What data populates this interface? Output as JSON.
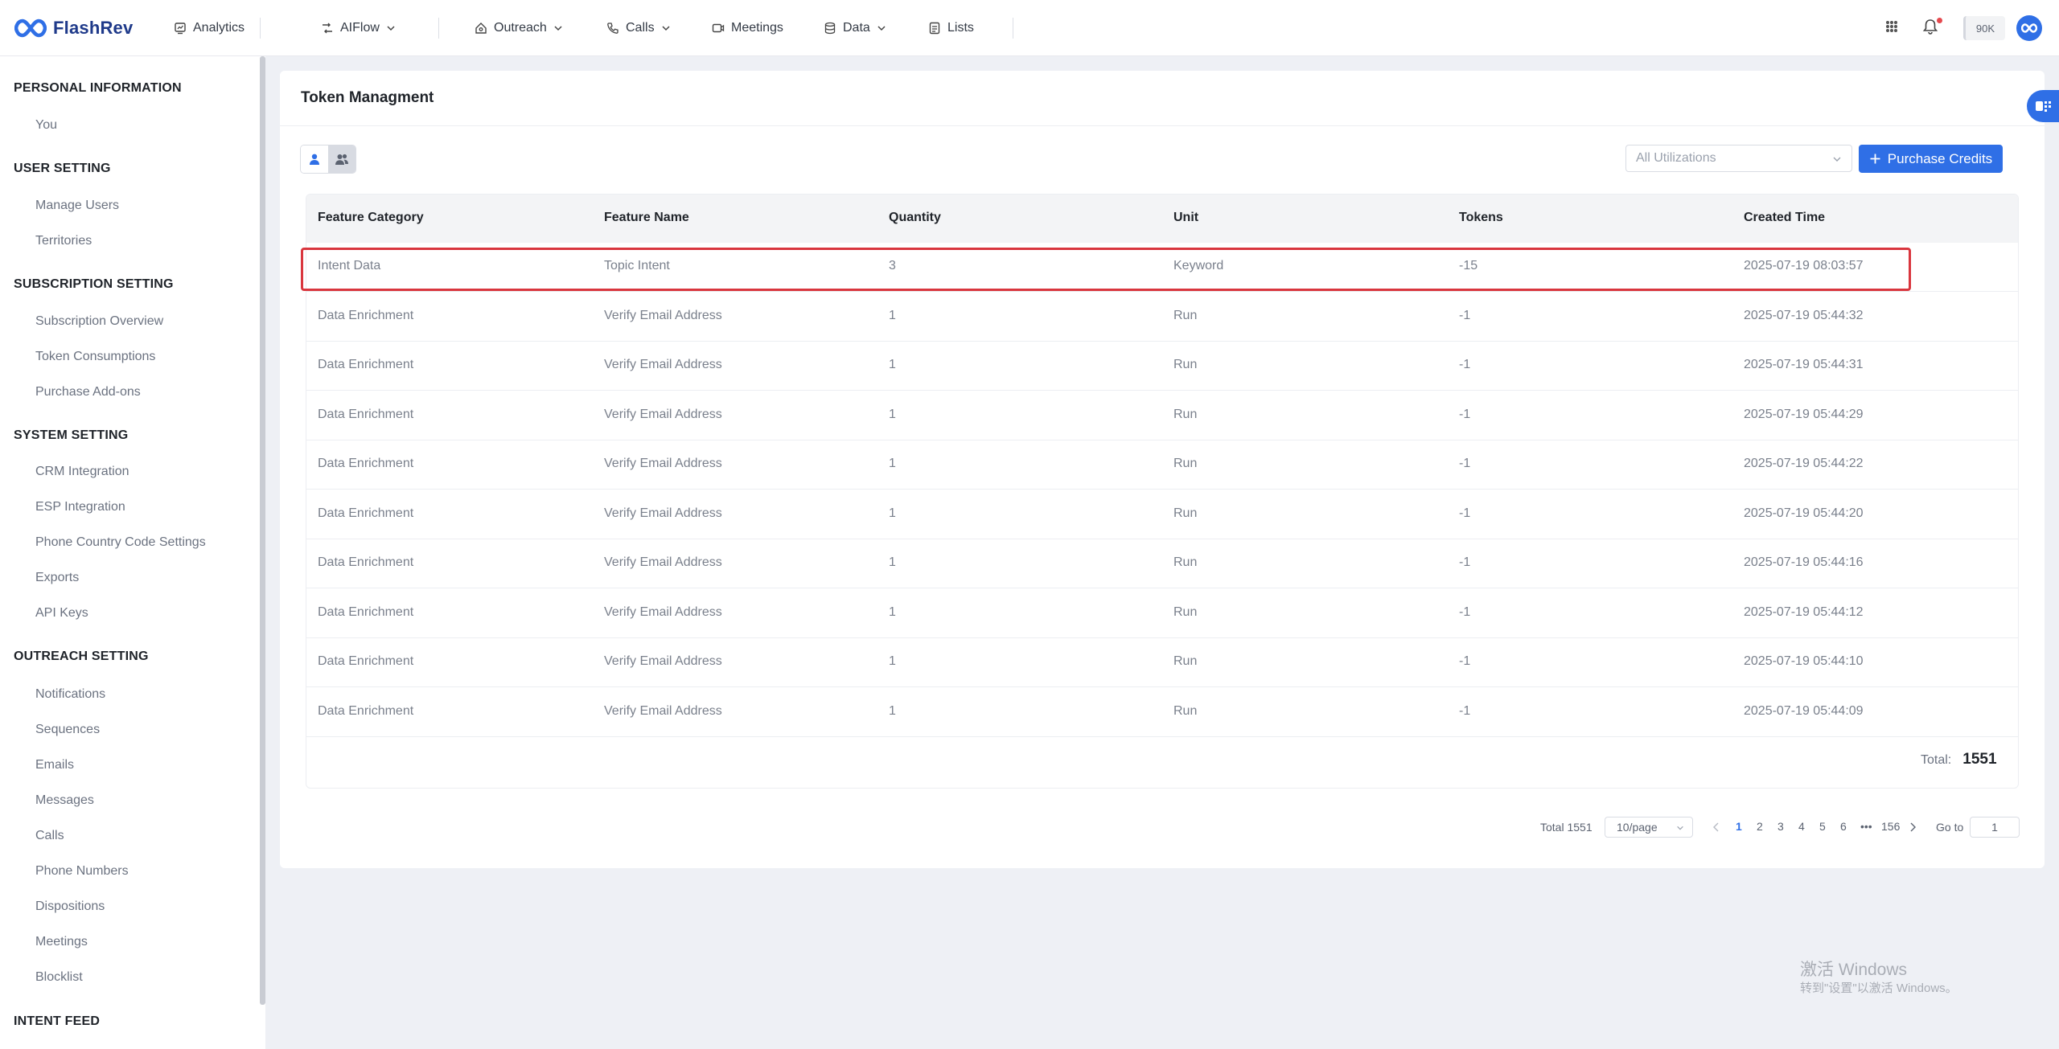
{
  "app": {
    "name": "FlashRev"
  },
  "nav": {
    "items": [
      {
        "label": "Analytics",
        "icon": "analytics-icon"
      },
      {
        "label": "AIFlow",
        "icon": "flow-icon"
      },
      {
        "label": "Outreach",
        "icon": "outreach-icon"
      },
      {
        "label": "Calls",
        "icon": "phone-icon"
      },
      {
        "label": "Meetings",
        "icon": "video-icon"
      },
      {
        "label": "Data",
        "icon": "database-icon"
      },
      {
        "label": "Lists",
        "icon": "list-icon"
      }
    ],
    "credits": "90K"
  },
  "sidebar": {
    "sections": [
      {
        "title": "PERSONAL INFORMATION",
        "items": [
          "You"
        ]
      },
      {
        "title": "USER SETTING",
        "items": [
          "Manage Users",
          "Territories"
        ]
      },
      {
        "title": "SUBSCRIPTION SETTING",
        "items": [
          "Subscription Overview",
          "Token Consumptions",
          "Purchase Add-ons"
        ]
      },
      {
        "title": "SYSTEM SETTING",
        "items": [
          "CRM Integration",
          "ESP Integration",
          "Phone Country Code Settings",
          "Exports",
          "API Keys"
        ]
      },
      {
        "title": "OUTREACH SETTING",
        "items": [
          "Notifications",
          "Sequences",
          "Emails",
          "Messages",
          "Calls",
          "Phone Numbers",
          "Dispositions",
          "Meetings",
          "Blocklist"
        ]
      },
      {
        "title": "INTENT FEED",
        "items": []
      }
    ]
  },
  "main": {
    "title": "Token Managment",
    "filter": {
      "placeholder": "All Utilizations"
    },
    "purchase_button": "Purchase Credits",
    "table": {
      "columns": [
        "Feature Category",
        "Feature Name",
        "Quantity",
        "Unit",
        "Tokens",
        "Created Time"
      ],
      "rows": [
        [
          "Intent Data",
          "Topic Intent",
          "3",
          "Keyword",
          "-15",
          "2025-07-19 08:03:57"
        ],
        [
          "Data Enrichment",
          "Verify Email Address",
          "1",
          "Run",
          "-1",
          "2025-07-19 05:44:32"
        ],
        [
          "Data Enrichment",
          "Verify Email Address",
          "1",
          "Run",
          "-1",
          "2025-07-19 05:44:31"
        ],
        [
          "Data Enrichment",
          "Verify Email Address",
          "1",
          "Run",
          "-1",
          "2025-07-19 05:44:29"
        ],
        [
          "Data Enrichment",
          "Verify Email Address",
          "1",
          "Run",
          "-1",
          "2025-07-19 05:44:22"
        ],
        [
          "Data Enrichment",
          "Verify Email Address",
          "1",
          "Run",
          "-1",
          "2025-07-19 05:44:20"
        ],
        [
          "Data Enrichment",
          "Verify Email Address",
          "1",
          "Run",
          "-1",
          "2025-07-19 05:44:16"
        ],
        [
          "Data Enrichment",
          "Verify Email Address",
          "1",
          "Run",
          "-1",
          "2025-07-19 05:44:12"
        ],
        [
          "Data Enrichment",
          "Verify Email Address",
          "1",
          "Run",
          "-1",
          "2025-07-19 05:44:10"
        ],
        [
          "Data Enrichment",
          "Verify Email Address",
          "1",
          "Run",
          "-1",
          "2025-07-19 05:44:09"
        ]
      ],
      "total_label": "Total:",
      "total_value": "1551"
    },
    "pagination": {
      "total_text": "Total 1551",
      "page_size": "10/page",
      "pages": [
        "1",
        "2",
        "3",
        "4",
        "5",
        "6",
        "•••",
        "156"
      ],
      "current": "1",
      "goto_label": "Go to",
      "goto_value": "1"
    }
  },
  "watermark": {
    "line1": "激活 Windows",
    "line2": "转到\"设置\"以激活 Windows。"
  },
  "colors": {
    "accent": "#2f6fe6",
    "highlight": "#d9363e",
    "background": "#eef0f5"
  }
}
